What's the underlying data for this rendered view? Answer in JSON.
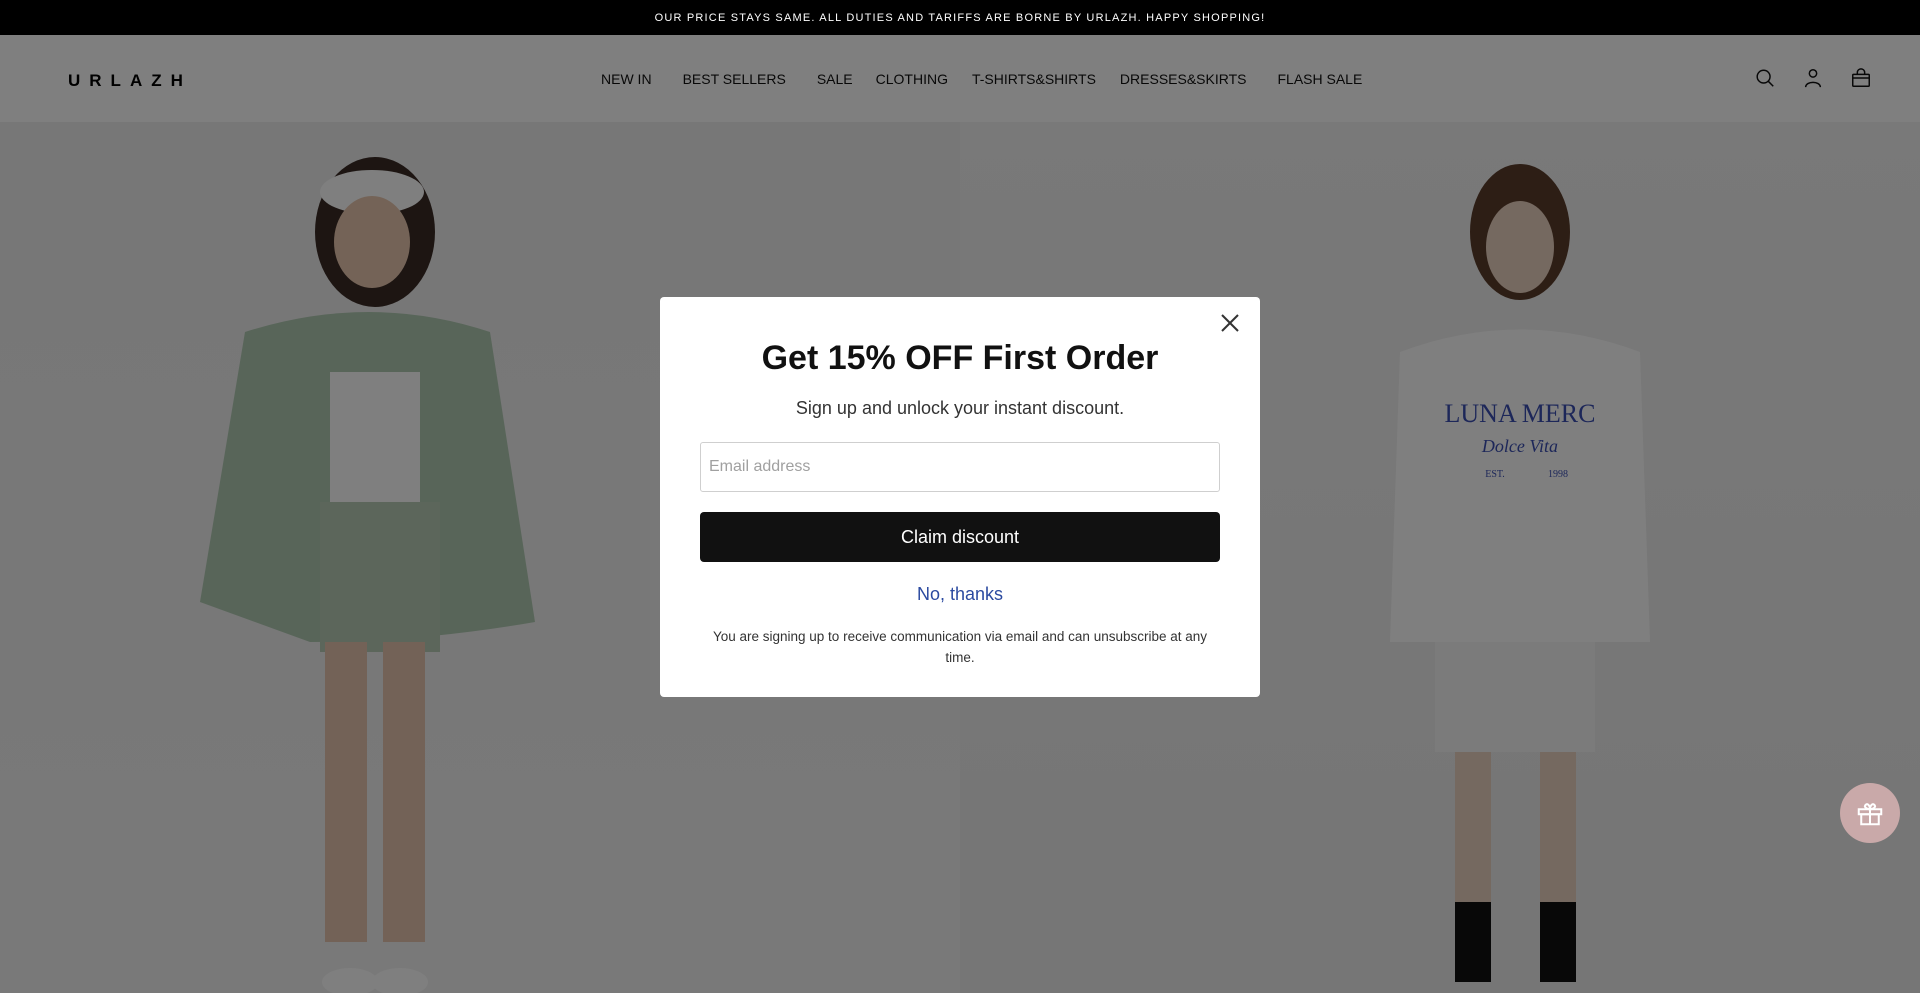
{
  "announcement": "OUR PRICE STAYS SAME. ALL DUTIES AND TARIFFS ARE BORNE BY URLAZH. HAPPY SHOPPING!",
  "header": {
    "logo": "URLAZH",
    "nav": [
      "NEW IN",
      "BEST SELLERS",
      "SALE",
      "CLOTHING",
      "T-SHIRTS&SHIRTS",
      "DRESSES&SKIRTS",
      "FLASH SALE"
    ],
    "icons": [
      "search-icon",
      "account-icon",
      "cart-icon"
    ]
  },
  "hero": {
    "left_model_outfit": "mint green jacket and shorts with white cap",
    "right_model_tee_print": [
      "LUNA MERC",
      "Dolce Vita",
      "EST.",
      "1998"
    ]
  },
  "modal": {
    "title": "Get 15% OFF First Order",
    "subtitle": "Sign up and unlock your instant discount.",
    "email_placeholder": "Email address",
    "email_value": "",
    "claim_label": "Claim discount",
    "decline_label": "No, thanks",
    "disclaimer": "You are signing up to receive communication via email and can unsubscribe at any time."
  },
  "colors": {
    "announcement_bg": "#000000",
    "overlay": "rgba(0,0,0,0.5)",
    "claim_button_bg": "#111111",
    "decline_link": "#2b4aa0",
    "gift_button_bg": "#c9a9a9"
  }
}
